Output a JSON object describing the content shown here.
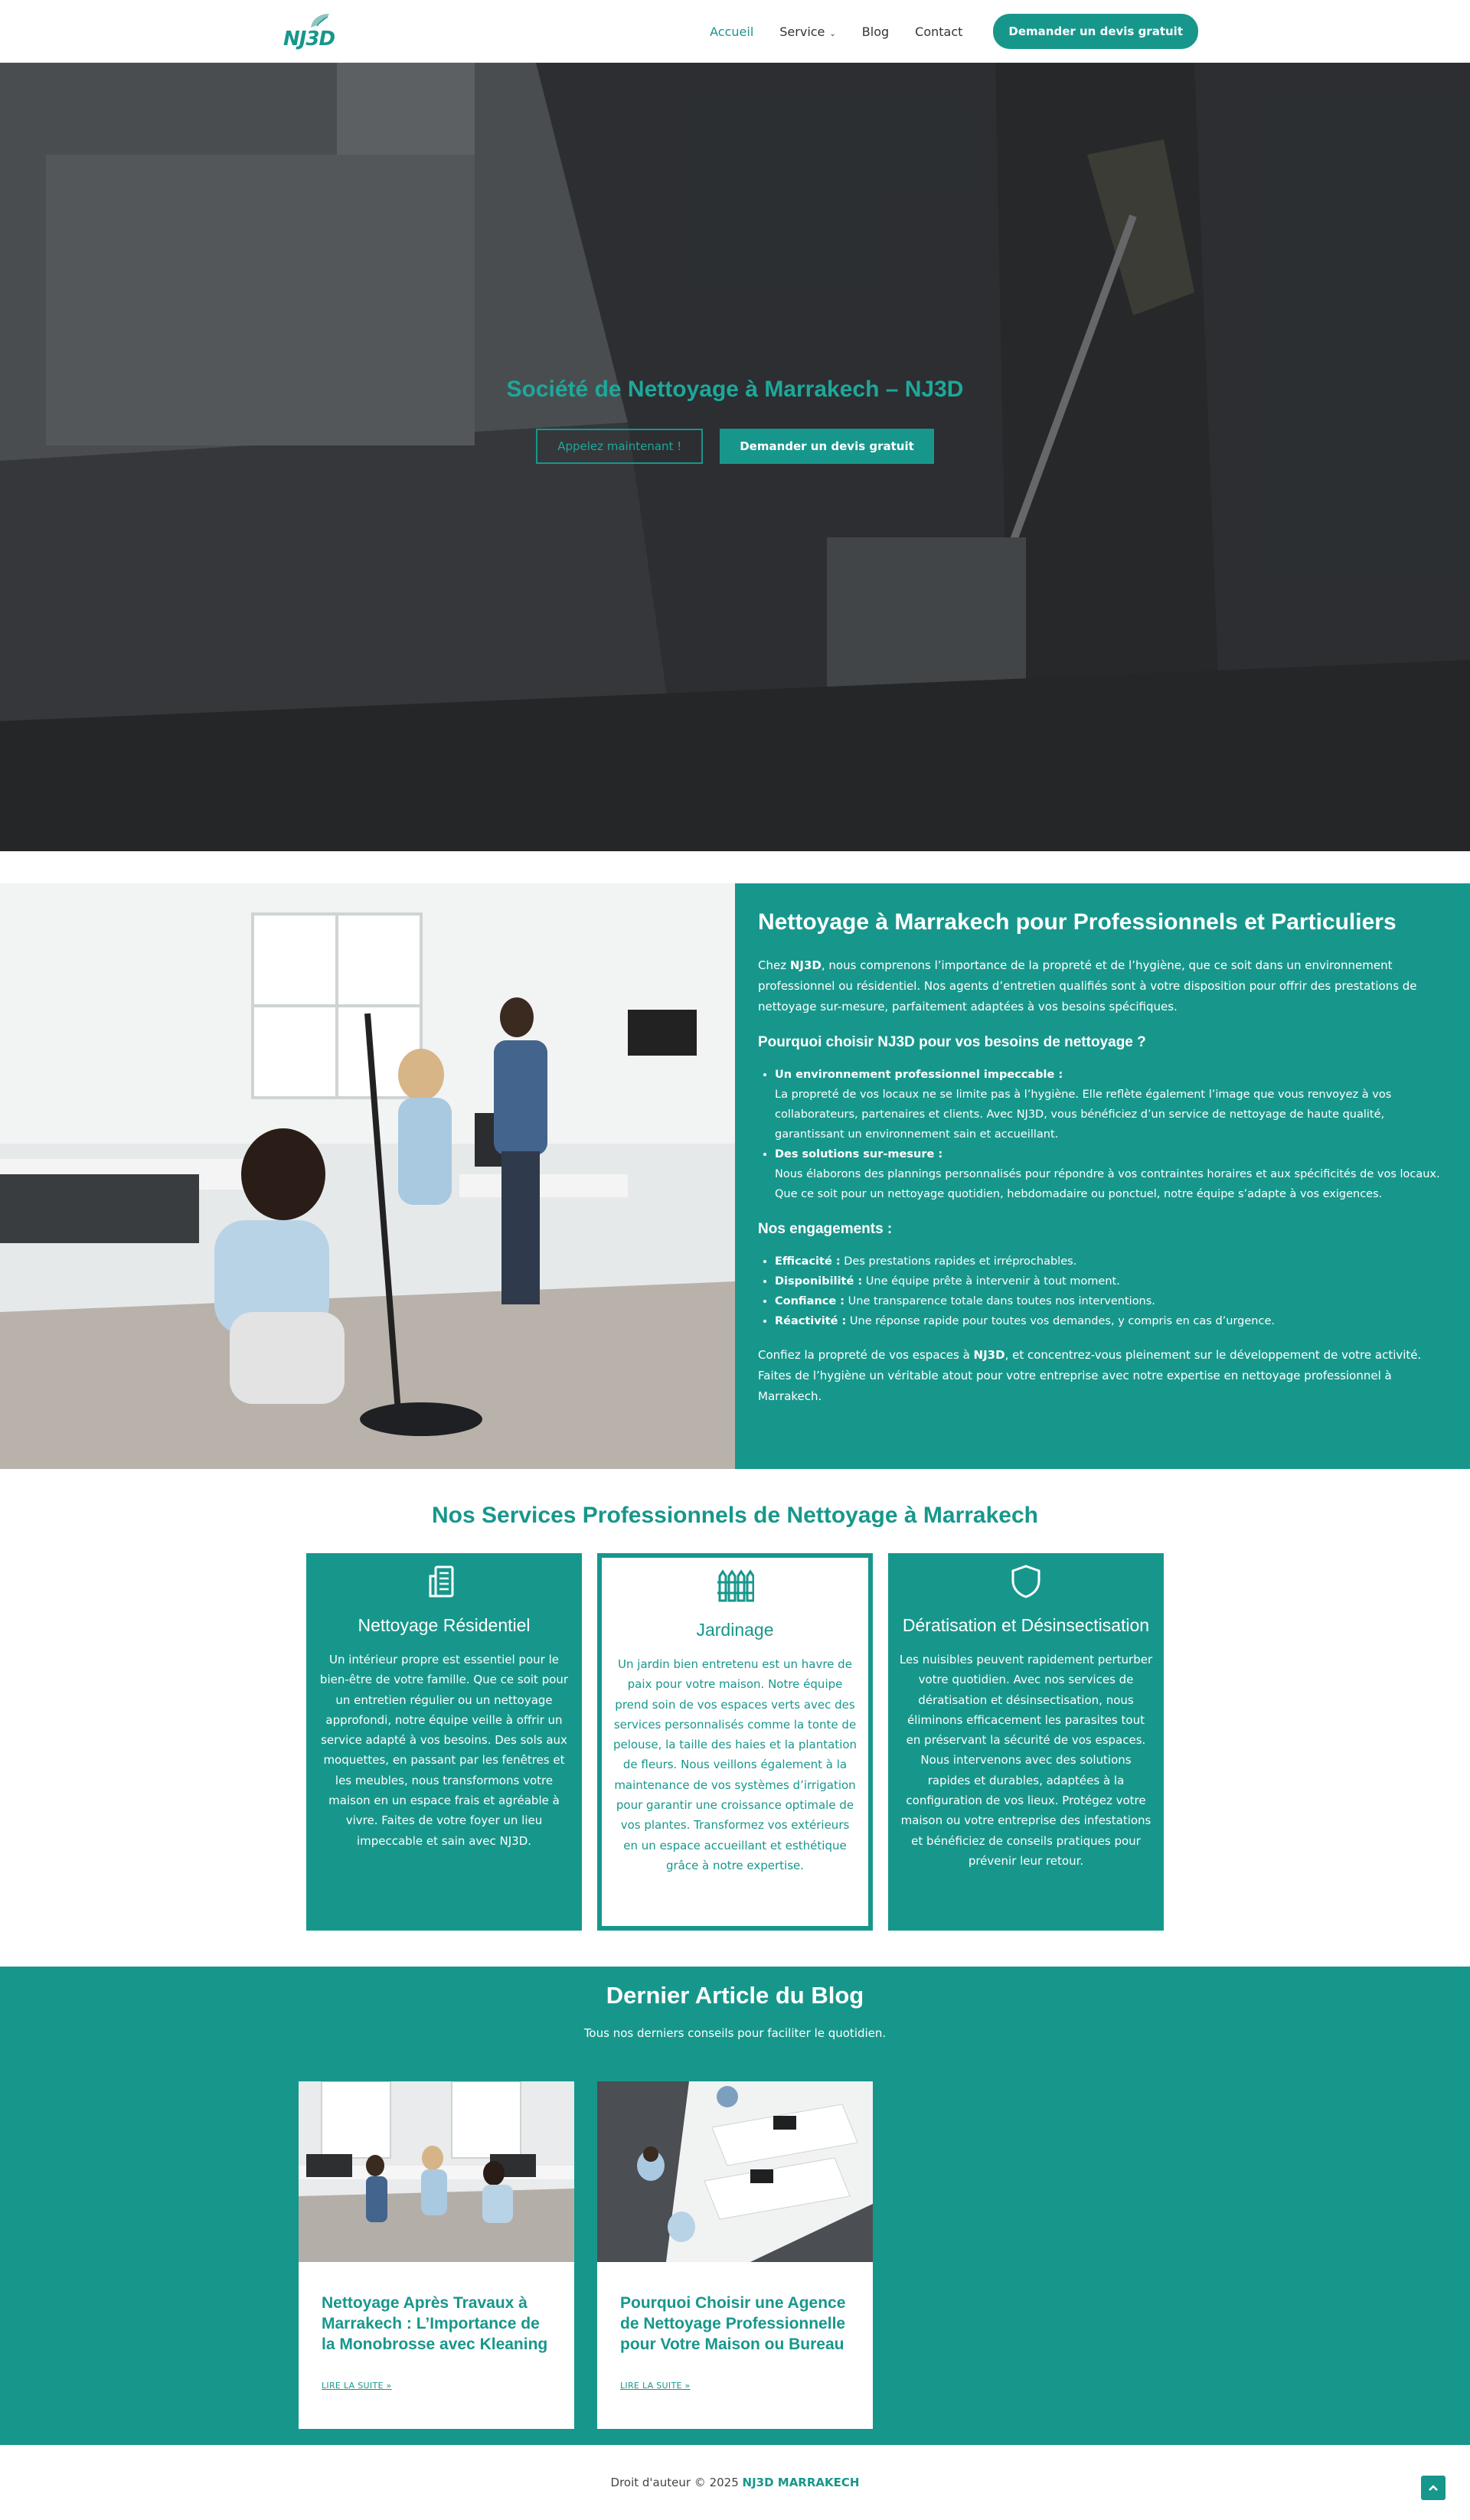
{
  "header": {
    "logo_text": "NJ3D",
    "nav": [
      {
        "label": "Accueil"
      },
      {
        "label": "Service"
      },
      {
        "label": "Blog"
      },
      {
        "label": "Contact"
      }
    ],
    "cta_label": "Demander un devis gratuit"
  },
  "hero": {
    "title": "Société de Nettoyage à Marrakech – NJ3D",
    "btn_call": "Appelez maintenant !",
    "btn_quote": "Demander un devis gratuit"
  },
  "about": {
    "title": "Nettoyage à Marrakech pour Professionnels et Particuliers",
    "intro_prefix": "Chez ",
    "intro_brand": "NJ3D",
    "intro_rest": ", nous comprenons l’importance de la propreté et de l’hygiène, que ce soit dans un environnement professionnel ou résidentiel. Nos agents d’entretien qualifiés sont à votre disposition pour offrir des prestations de nettoyage sur-mesure, parfaitement adaptées à vos besoins spécifiques.",
    "why_title": "Pourquoi choisir NJ3D pour vos besoins de nettoyage ?",
    "why_items": [
      {
        "title": "Un environnement professionnel impeccable :",
        "text": "La propreté de vos locaux ne se limite pas à l’hygiène. Elle reflète également l’image que vous renvoyez à vos collaborateurs, partenaires et clients. Avec NJ3D, vous bénéficiez d’un service de nettoyage de haute qualité, garantissant un environnement sain et accueillant."
      },
      {
        "title": "Des solutions sur-mesure :",
        "text": "Nous élaborons des plannings personnalisés pour répondre à vos contraintes horaires et aux spécificités de vos locaux. Que ce soit pour un nettoyage quotidien, hebdomadaire ou ponctuel, notre équipe s’adapte à vos exigences."
      }
    ],
    "commit_title": "Nos engagements :",
    "commit_items": [
      {
        "title": "Efficacité :",
        "text": " Des prestations rapides et irréprochables."
      },
      {
        "title": "Disponibilité :",
        "text": " Une équipe prête à intervenir à tout moment."
      },
      {
        "title": "Confiance :",
        "text": " Une transparence totale dans toutes nos interventions."
      },
      {
        "title": "Réactivité :",
        "text": " Une réponse rapide pour toutes vos demandes, y compris en cas d’urgence."
      }
    ],
    "final_prefix": "Confiez la propreté de vos espaces à ",
    "final_brand": "NJ3D",
    "final_rest": ", et concentrez-vous pleinement sur le développement de votre activité. Faites de l’hygiène un véritable atout pour votre entreprise avec notre expertise en nettoyage professionnel à Marrakech."
  },
  "services": {
    "title": "Nos Services Professionnels de Nettoyage à Marrakech",
    "cards": [
      {
        "icon": "building-icon",
        "title": "Nettoyage Résidentiel",
        "text": "Un intérieur propre est essentiel pour le bien-être de votre famille. Que ce soit pour un entretien régulier ou un nettoyage approfondi, notre équipe veille à offrir un service adapté à vos besoins. Des sols aux moquettes, en passant par les fenêtres et les meubles, nous transformons votre maison en un espace frais et agréable à vivre. Faites de votre foyer un lieu impeccable et sain avec NJ3D."
      },
      {
        "icon": "fence-icon",
        "title": "Jardinage",
        "text": "Un jardin bien entretenu est un havre de paix pour votre maison. Notre équipe prend soin de vos espaces verts avec des services personnalisés comme la tonte de pelouse, la taille des haies et la plantation de fleurs. Nous veillons également à la maintenance de vos systèmes d’irrigation pour garantir une croissance optimale de vos plantes. Transformez vos extérieurs en un espace accueillant et esthétique grâce à notre expertise."
      },
      {
        "icon": "shield-icon",
        "title": "Dératisation et Désinsectisation",
        "text": "Les nuisibles peuvent rapidement perturber votre quotidien. Avec nos services de dératisation et désinsectisation, nous éliminons efficacement les parasites tout en préservant la sécurité de vos espaces. Nous intervenons avec des solutions rapides et durables, adaptées à la configuration de vos lieux. Protégez votre maison ou votre entreprise des infestations et bénéficiez de conseils pratiques pour prévenir leur retour."
      }
    ]
  },
  "blog": {
    "title": "Dernier Article du Blog",
    "subtitle": "Tous nos derniers conseils pour faciliter le quotidien.",
    "posts": [
      {
        "title": "Nettoyage Après Travaux à Marrakech : L’Importance de la Monobrosse avec Kleaning",
        "more": "LIRE LA SUITE »"
      },
      {
        "title": "Pourquoi Choisir une Agence de Nettoyage Professionnelle pour Votre Maison ou Bureau",
        "more": "LIRE LA SUITE »"
      }
    ]
  },
  "footer": {
    "copy_prefix": "Droit d'auteur © 2025 ",
    "copy_brand": "NJ3D MARRAKECH"
  }
}
